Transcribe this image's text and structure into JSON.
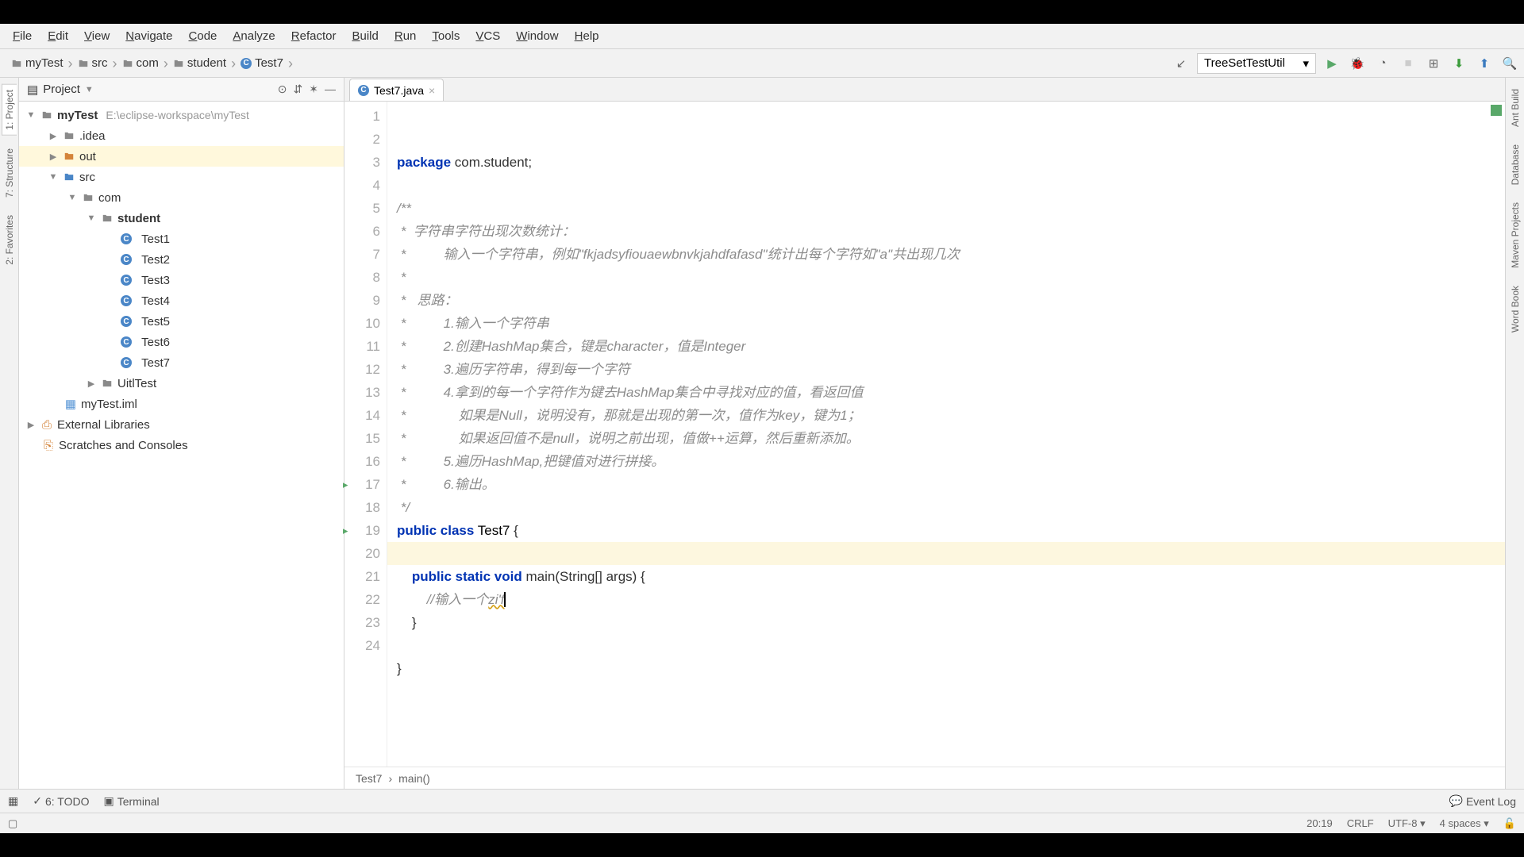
{
  "menu": [
    "File",
    "Edit",
    "View",
    "Navigate",
    "Code",
    "Analyze",
    "Refactor",
    "Build",
    "Run",
    "Tools",
    "VCS",
    "Window",
    "Help"
  ],
  "breadcrumbs": [
    {
      "icon": "folder",
      "label": "myTest"
    },
    {
      "icon": "folder",
      "label": "src"
    },
    {
      "icon": "folder",
      "label": "com"
    },
    {
      "icon": "folder",
      "label": "student"
    },
    {
      "icon": "class",
      "label": "Test7"
    }
  ],
  "run_config": "TreeSetTestUtil",
  "panel": {
    "title": "Project"
  },
  "tree": {
    "root": {
      "name": "myTest",
      "path": "E:\\eclipse-workspace\\myTest"
    },
    "idea": ".idea",
    "out": "out",
    "src": "src",
    "com": "com",
    "student": "student",
    "tests": [
      "Test1",
      "Test2",
      "Test3",
      "Test4",
      "Test5",
      "Test6",
      "Test7"
    ],
    "uitl": "UitlTest",
    "iml": "myTest.iml",
    "ext": "External Libraries",
    "scratch": "Scratches and Consoles"
  },
  "tab": {
    "name": "Test7.java"
  },
  "code": {
    "l1": "package com.student;",
    "l3": "/**",
    "l4": " *  字符串字符出现次数统计：",
    "l5a": " *          输入一个字符串，例如\"",
    "l5b": "fkjadsyfiouaewbnvkjahdfafasd",
    "l5c": "\"统计出每个字符如\"a\"共出现几次",
    "l6": " *",
    "l7": " *   思路：",
    "l8": " *          1.输入一个字符串",
    "l9": " *          2.创建HashMap集合，键是character，值是Integer",
    "l10": " *          3.遍历字符串，得到每一个字符",
    "l11": " *          4.拿到的每一个字符作为键去HashMap集合中寻找对应的值，看返回值",
    "l12": " *              如果是Null，说明没有，那就是出现的第一次，值作为key，键为1；",
    "l13": " *              如果返回值不是null，说明之前出现，值做++运算，然后重新添加。",
    "l14": " *          5.遍历HashMap,把键值对进行拼接。",
    "l15": " *          6.输出。",
    "l16": " */",
    "l17a": "public class ",
    "l17b": "Test7",
    "l17c": " {",
    "l19a": "    public static void ",
    "l19b": "main",
    "l19c": "(String[] args) {",
    "l20a": "        //输入一个",
    "l20b": "zi'f",
    "l21": "    }",
    "l23": "}"
  },
  "editor_breadcrumb": [
    "Test7",
    "main()"
  ],
  "bottom": {
    "todo": "6: TODO",
    "terminal": "Terminal",
    "eventlog": "Event Log"
  },
  "status": {
    "pos": "20:19",
    "eol": "CRLF",
    "enc": "UTF-8",
    "spaces": "4 spaces"
  },
  "right_tabs": [
    "Ant Build",
    "Database",
    "Maven Projects",
    "Word Book"
  ],
  "left_tabs": [
    "1: Project",
    "7: Structure",
    "2: Favorites"
  ]
}
